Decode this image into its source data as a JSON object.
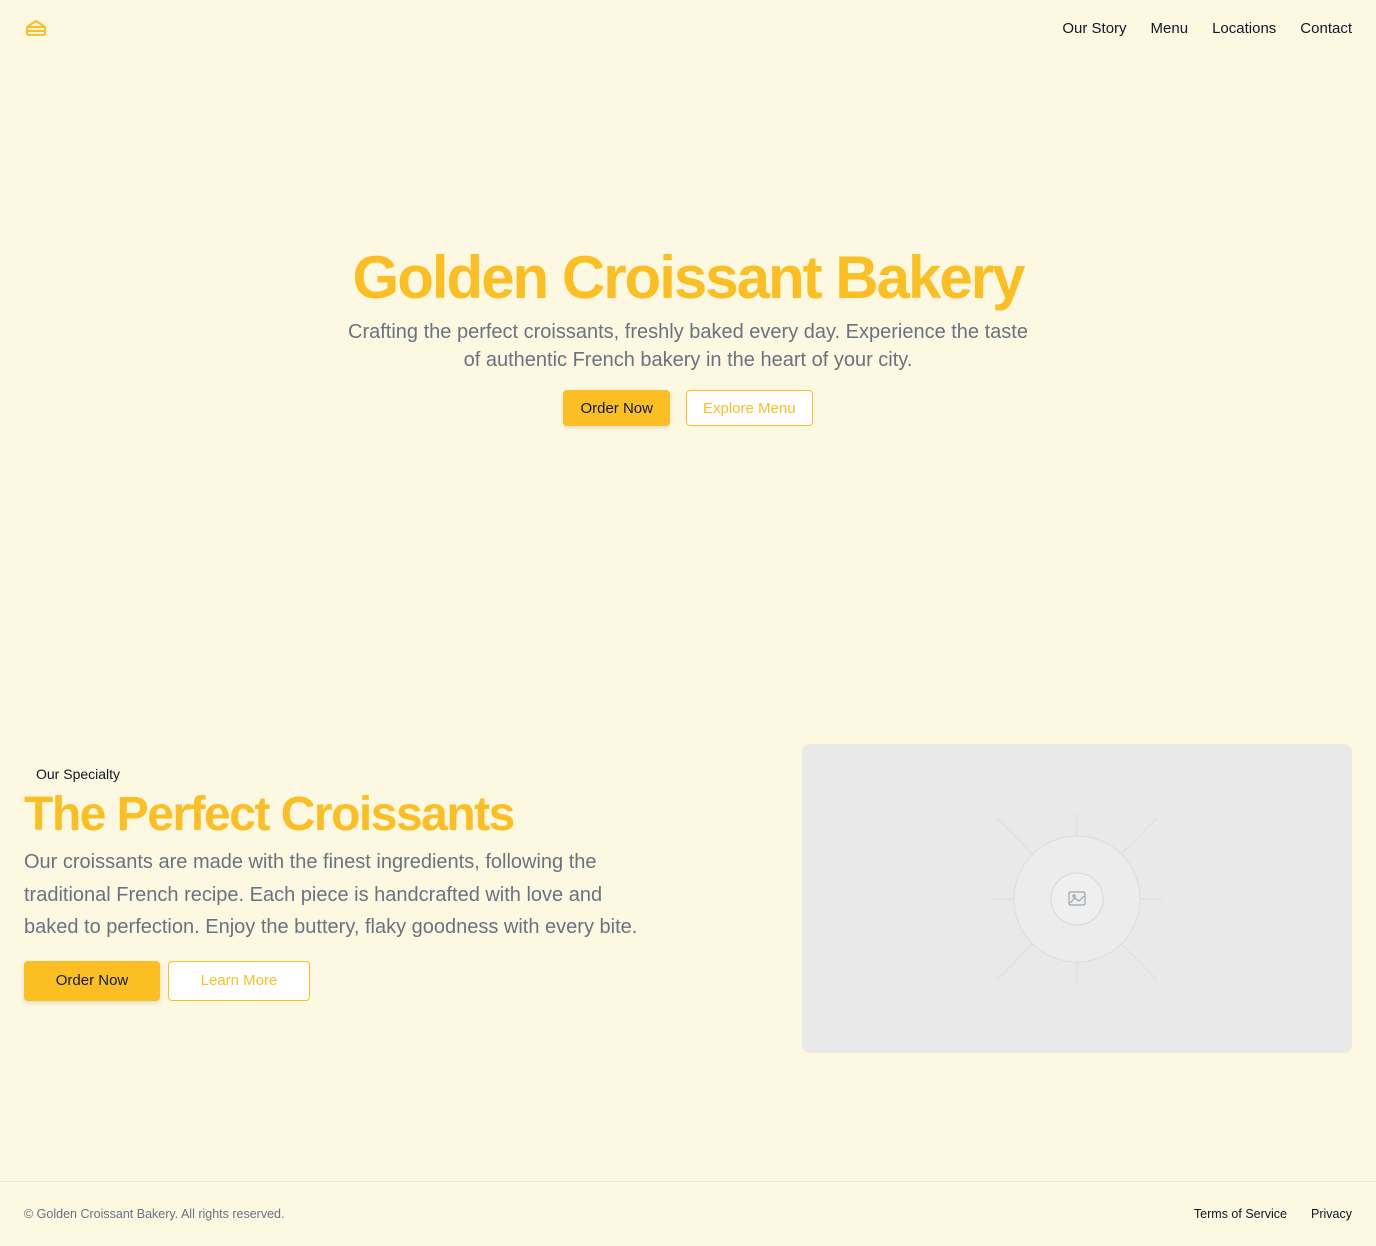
{
  "header": {
    "logo_icon": "bread-slice-icon",
    "nav": [
      {
        "label": "Our Story"
      },
      {
        "label": "Menu"
      },
      {
        "label": "Locations"
      },
      {
        "label": "Contact"
      }
    ]
  },
  "hero": {
    "title": "Golden Croissant Bakery",
    "subtitle": "Crafting the perfect croissants, freshly baked every day. Experience the taste of authentic French bakery in the heart of your city.",
    "primary_button": "Order Now",
    "secondary_button": "Explore Menu"
  },
  "specialty": {
    "eyebrow": "Our Specialty",
    "title": "The Perfect Croissants",
    "description": "Our croissants are made with the finest ingredients, following the traditional French recipe. Each piece is handcrafted with love and baked to perfection. Enjoy the buttery, flaky goodness with every bite.",
    "primary_button": "Order Now",
    "secondary_button": "Learn More",
    "image_icon": "image-placeholder-icon"
  },
  "footer": {
    "copyright": "© Golden Croissant Bakery. All rights reserved.",
    "links": [
      {
        "label": "Terms of Service"
      },
      {
        "label": "Privacy"
      }
    ]
  },
  "colors": {
    "background": "#fdf8e1",
    "accent": "#fbbf24",
    "muted_text": "#6b7280",
    "placeholder": "#e9e9e9"
  }
}
